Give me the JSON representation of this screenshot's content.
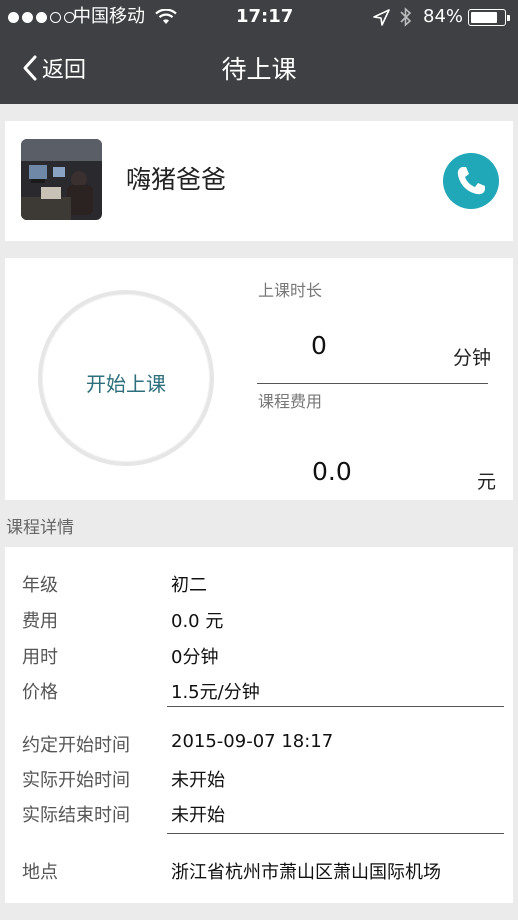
{
  "status_bar": {
    "carrier": "中国移动",
    "time": "17:17",
    "battery": "84%",
    "battery_level": 0.84
  },
  "nav": {
    "back_label": "返回",
    "title": "待上课"
  },
  "contact": {
    "name": "嗨猪爸爸"
  },
  "session": {
    "start_button": "开始上课",
    "duration_label": "上课时长",
    "duration_value": "0",
    "duration_unit": "分钟",
    "fee_label": "课程费用",
    "fee_value": "0.0",
    "fee_unit": "元"
  },
  "details": {
    "title": "课程详情",
    "grade": {
      "label": "年级",
      "value": "初二"
    },
    "fee": {
      "label": "费用",
      "value": "0.0 元"
    },
    "time_used": {
      "label": "用时",
      "value": "0分钟"
    },
    "price": {
      "label": "价格",
      "value": "1.5元/分钟"
    },
    "scheduled_start": {
      "label": "约定开始时间",
      "value": "2015-09-07 18:17"
    },
    "actual_start": {
      "label": "实际开始时间",
      "value": "未开始"
    },
    "actual_end": {
      "label": "实际结束时间",
      "value": "未开始"
    },
    "location": {
      "label": "地点",
      "value": "浙江省杭州市萧山区萧山国际机场"
    }
  }
}
